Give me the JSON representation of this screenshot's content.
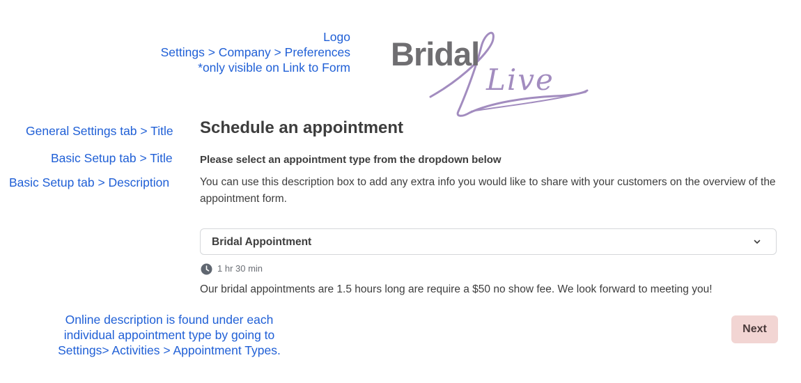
{
  "annotations": {
    "logo": [
      "Logo",
      "Settings > Company > Preferences",
      "*only visible on Link to Form"
    ],
    "general_title": "General Settings tab > Title",
    "basic_title": "Basic Setup tab > Title",
    "basic_description": "Basic Setup tab > Description",
    "online_description": [
      "Online description is found under each",
      "individual  appointment type by going to",
      "Settings> Activities >  Appointment Types."
    ]
  },
  "logo": {
    "word": "Bridal",
    "script_word": "Live",
    "color_gray": "#6f6e71",
    "color_purple": "#a28cbf"
  },
  "form": {
    "title": "Schedule an appointment",
    "subtitle": "Please select an appointment type from the dropdown below",
    "description": "You can use this description box to add any extra info you would like to share with your customers on the overview of the appointment form.",
    "appointment_type": {
      "selected": "Bridal Appointment",
      "icon": "chevron-down-icon"
    },
    "duration": {
      "icon": "clock-icon",
      "text": "1 hr 30 min"
    },
    "appointment_description": "Our bridal appointments are 1.5 hours long are require a $50 no show fee. We look forward to meeting you!",
    "next_label": "Next"
  },
  "colors": {
    "annotation": "#1f5fd6",
    "next_button_bg": "#f2d5d3",
    "text": "#3d3d3d"
  }
}
